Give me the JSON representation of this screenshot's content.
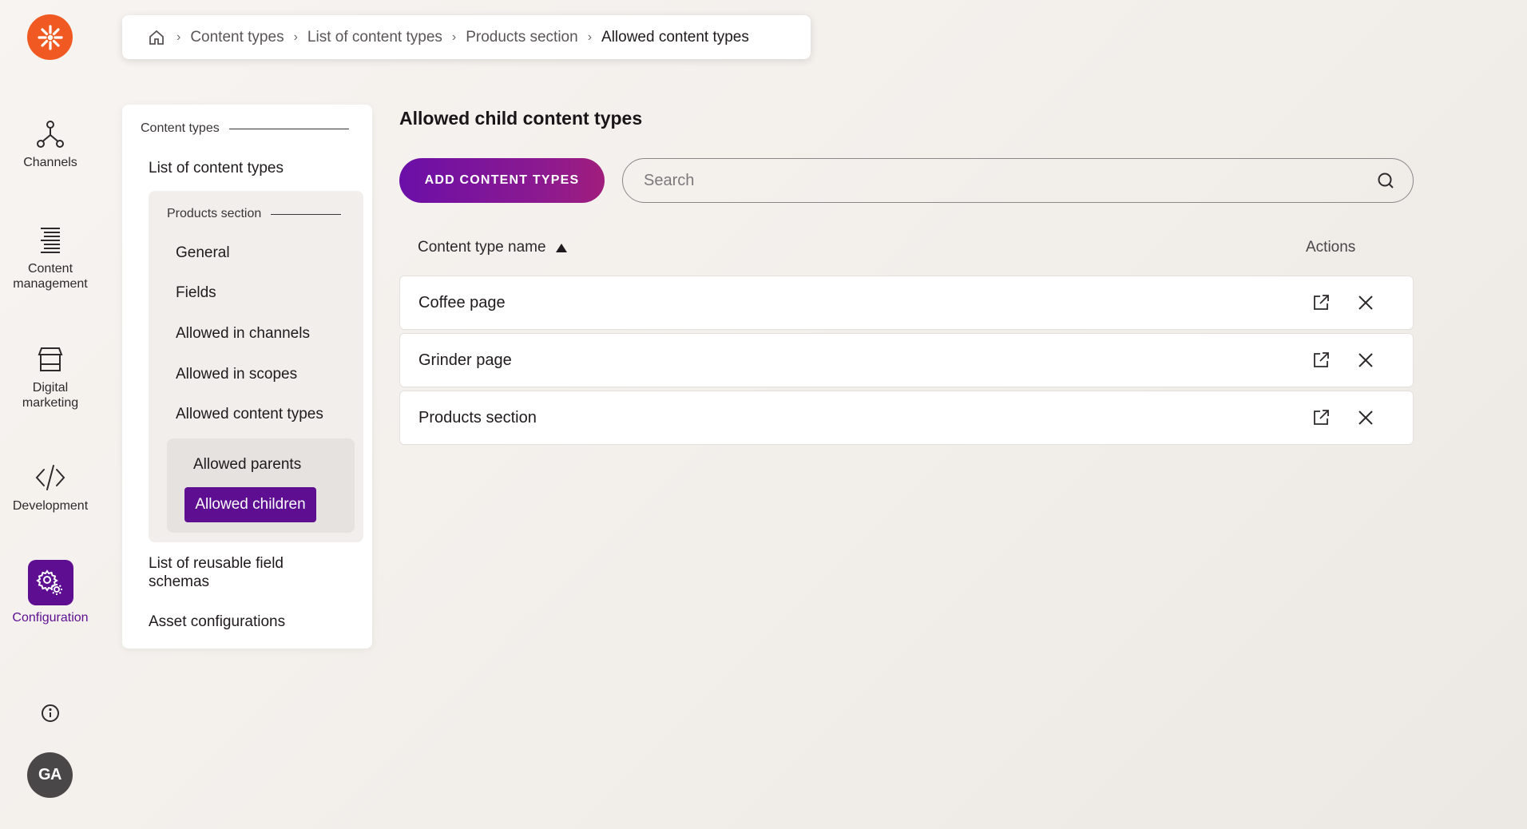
{
  "rail": {
    "items": [
      {
        "label": "Channels",
        "icon": "channels-icon"
      },
      {
        "label": "Content\nmanagement",
        "icon": "content-management-icon"
      },
      {
        "label": "Digital\nmarketing",
        "icon": "digital-marketing-icon"
      },
      {
        "label": "Development",
        "icon": "development-icon"
      },
      {
        "label": "Configuration",
        "icon": "configuration-icon",
        "active": true
      }
    ],
    "avatar_initials": "GA"
  },
  "breadcrumb": {
    "items": [
      "Content types",
      "List of content types",
      "Products section",
      "Allowed content types"
    ]
  },
  "nav": {
    "group_title": "Content types",
    "list_link": "List of content types",
    "subgroup_title": "Products section",
    "sub_items": [
      "General",
      "Fields",
      "Allowed in channels",
      "Allowed in scopes",
      "Allowed content types"
    ],
    "subsub_items": [
      "Allowed parents",
      "Allowed children"
    ],
    "bottom_items": [
      "List of reusable field\nschemas",
      "Asset configurations"
    ]
  },
  "main": {
    "title": "Allowed child content types",
    "add_button": "ADD CONTENT TYPES",
    "search_placeholder": "Search",
    "col_name": "Content type name",
    "col_actions": "Actions",
    "rows": [
      "Coffee page",
      "Grinder page",
      "Products section"
    ]
  },
  "colors": {
    "brand_orange": "#f05a22",
    "accent_purple": "#5e0e91"
  }
}
